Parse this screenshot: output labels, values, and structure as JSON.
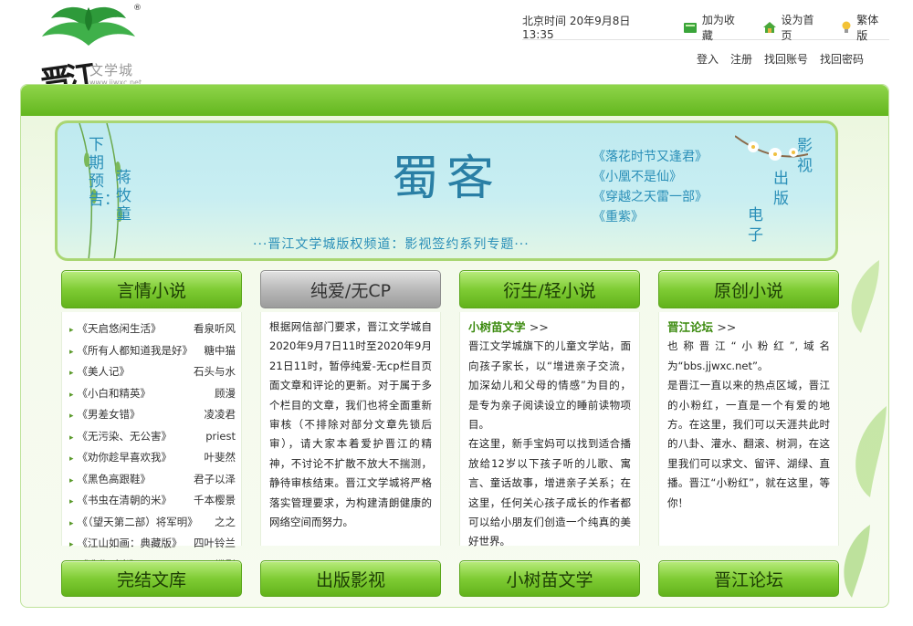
{
  "logo": {
    "brand": "晋江",
    "name": "文学城",
    "url": "www.jjwxc.net",
    "reg_mark": "®"
  },
  "topbar": {
    "time": "北京时间 20年9月8日 13:35",
    "bookmark": "加为收藏",
    "homepage": "设为首页",
    "traditional": "繁体版"
  },
  "account": {
    "login": "登入",
    "register": "注册",
    "recover_account": "找回账号",
    "recover_password": "找回密码"
  },
  "banner": {
    "preview_1": "下期预告：",
    "preview_2": "蒋牧童",
    "main_title": "蜀客",
    "titles": [
      "《落花时节又逢君》",
      "《小凰不是仙》",
      "《穿越之天雷一部》",
      "《重紫》"
    ],
    "vert_1": "电子",
    "vert_2": "出版",
    "vert_3": "影视",
    "slogan": "···晋江文学城版权频道：影视签约系列专题···"
  },
  "columns": {
    "romance": {
      "tab": "言情小说",
      "items": [
        {
          "title": "《天启悠闲生活》",
          "author": "看泉听风"
        },
        {
          "title": "《所有人都知道我是好》",
          "author": "糖中猫"
        },
        {
          "title": "《美人记》",
          "author": "石头与水"
        },
        {
          "title": "《小白和精英》",
          "author": "顾漫"
        },
        {
          "title": "《男差女错》",
          "author": "凌凌君"
        },
        {
          "title": "《无污染、无公害》",
          "author": "priest"
        },
        {
          "title": "《劝你趁早喜欢我》",
          "author": "叶斐然"
        },
        {
          "title": "《黑色高跟鞋》",
          "author": "君子以泽"
        },
        {
          "title": "《书虫在清朝的米》",
          "author": "千本樱景"
        },
        {
          "title": "《（望天第二部）将军明》",
          "author": "之之"
        },
        {
          "title": "《江山如画：典藏版》",
          "author": "四叶铃兰"
        },
        {
          "title": "《造作时光》",
          "author": "月下蝶影"
        }
      ]
    },
    "bl": {
      "tab": "纯爱/无CP",
      "text": "根据网信部门要求，晋江文学城自2020年9月7日11时至2020年9月21日11时，暂停纯爱-无cp栏目页面文章和评论的更新。对于属于多个栏目的文章，我们也将全面重新审核（不排除对部分文章先锁后审），请大家本着爱护晋江的精神，不讨论不扩散不放大不揣测，静待审核结束。晋江文学城将严格落实管理要求，为构建清朗健康的网络空间而努力。"
    },
    "derivative": {
      "tab": "衍生/轻小说",
      "head": "小树苗文学",
      "arrow": ">>",
      "p1": "晋江文学城旗下的儿童文学站，面向孩子家长，以“增进亲子交流，加深幼儿和父母的情感”为目的，是专为亲子阅读设立的睡前读物项目。",
      "p2": "在这里，新手宝妈可以找到适合播放给12岁以下孩子听的儿歌、寓言、童话故事，增进亲子关系；在这里，任何关心孩子成长的作者都可以给小朋友们创造一个纯真的美好世界。"
    },
    "original": {
      "tab": "原创小说",
      "head": "晋江论坛",
      "arrow": ">>",
      "p1": "也称晋江“小粉红”,域名为“bbs.jjwxc.net”。",
      "p2": "是晋江一直以来的热点区域，晋江的小粉红，一直是一个有爱的地方。在这里，我们可以天涯共此时的八卦、灌水、翻滚、树洞，在这里我们可以求文、留评、湖绿、直播。晋江“小粉红”，就在这里，等你！"
    }
  },
  "bottom_tabs": [
    "完结文库",
    "出版影视",
    "小树苗文学",
    "晋江论坛"
  ],
  "colors": {
    "accent_green": "#63b61e",
    "link_green": "#3b8a0e",
    "banner_blue": "#2a8fb8"
  }
}
